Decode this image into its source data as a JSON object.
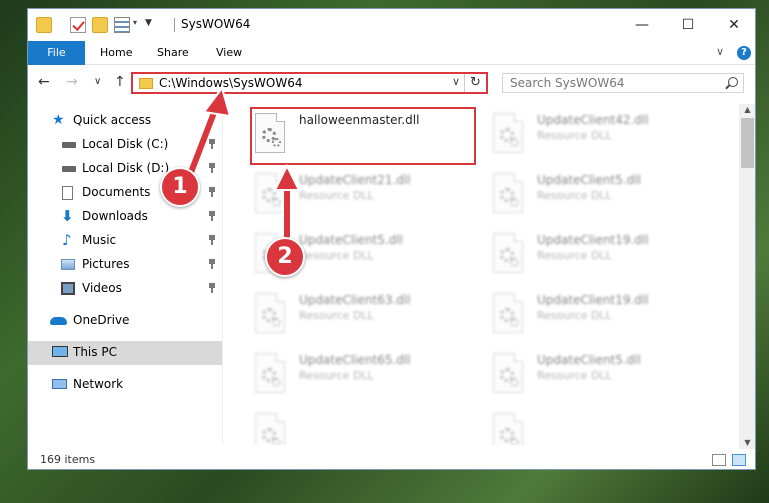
{
  "window": {
    "title": "SysWOW64",
    "minimize": "—",
    "maximize": "☐",
    "close": "✕"
  },
  "ribbon": {
    "tabs": [
      "File",
      "Home",
      "Share",
      "View"
    ],
    "expand": "∨"
  },
  "nav": {
    "back": "←",
    "forward": "→",
    "recent": "∨",
    "up": "↑",
    "address": "C:\\Windows\\SysWOW64",
    "address_dropdown": "∨",
    "refresh": "↻",
    "search_placeholder": "Search SysWOW64"
  },
  "sidebar": {
    "items": [
      {
        "label": "Quick access"
      },
      {
        "label": "Local Disk (C:)"
      },
      {
        "label": "Local Disk (D:)"
      },
      {
        "label": "Documents"
      },
      {
        "label": "Downloads"
      },
      {
        "label": "Music"
      },
      {
        "label": "Pictures"
      },
      {
        "label": "Videos"
      },
      {
        "label": "OneDrive"
      },
      {
        "label": "This PC"
      },
      {
        "label": "Network"
      }
    ]
  },
  "files": [
    {
      "name": "halloweenmaster.dll",
      "type": ""
    },
    {
      "name": "UpdateClient42.dll",
      "type": "Resource DLL"
    },
    {
      "name": "UpdateClient21.dll",
      "type": "Resource DLL"
    },
    {
      "name": "UpdateClient5.dll",
      "type": "Resource DLL"
    },
    {
      "name": "UpdateClient5.dll",
      "type": "Resource DLL"
    },
    {
      "name": "UpdateClient19.dll",
      "type": "Resource DLL"
    },
    {
      "name": "UpdateClient63.dll",
      "type": "Resource DLL"
    },
    {
      "name": "UpdateClient19.dll",
      "type": "Resource DLL"
    },
    {
      "name": "UpdateClient65.dll",
      "type": "Resource DLL"
    },
    {
      "name": "UpdateClient5.dll",
      "type": "Resource DLL"
    }
  ],
  "status": {
    "item_count": "169 items"
  },
  "annotations": {
    "badge_1": "1",
    "badge_2": "2",
    "color": "#d9373d"
  }
}
